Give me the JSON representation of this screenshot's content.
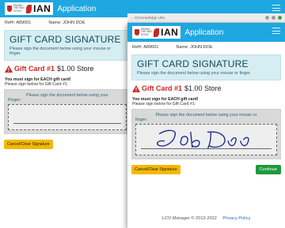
{
  "app": {
    "logo_small_text": "PAVING THE WAY GOOD",
    "logo_big_text": "IAN",
    "logo_swoosh_text": "HURRICANE",
    "title": "Application"
  },
  "record": {
    "ref": "Ref#: A89001",
    "name": "Name: JOHN DOE"
  },
  "signature_panel": {
    "heading": "GIFT CARD SIGNATURE",
    "instructions_back": "Please sign the document below using your mouse or",
    "instructions_back_2": "finger.",
    "instructions_front": "Please sign the document below using your mouse or finger."
  },
  "gift_card": {
    "label": "Gift Card #1",
    "amount": "$1.00 Store"
  },
  "notices": {
    "must_sign": "You must sign for EACH gift card!",
    "sign_below": "Please sign below for Gift Card #1:"
  },
  "sign_area": {
    "hint_back": "Please sign the document below using your",
    "finger_back": "Finger:",
    "hint_front": "Please sign the document below using your mouse or",
    "finger_front": "finger:",
    "signature_shown": "John Doe"
  },
  "buttons": {
    "cancel": "Cancel/Clear Signature",
    "continue": "Continue"
  },
  "browser": {
    "url_fragment": "... Chrome/Edge URL"
  },
  "footer": {
    "copyright": "LCO Manager © 2013-2022",
    "privacy": "Privacy Policy"
  },
  "colors": {
    "header_blue": "#1ea7e1",
    "warn_red": "#c62828",
    "panel_bg": "#d6edf2",
    "cancel_yellow": "#f5b800",
    "continue_green": "#1e9a3a"
  }
}
